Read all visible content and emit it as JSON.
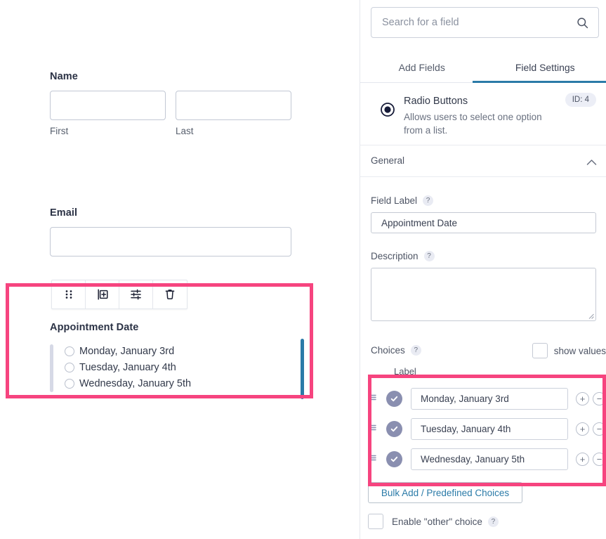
{
  "colors": {
    "highlight_pink": "#f6447f",
    "accent_blue": "#2b7ba8",
    "choice_check": "#8a8fb0",
    "active_bar": "#d6d9e6"
  },
  "form_preview": {
    "name_field": {
      "label": "Name",
      "first": {
        "value": "",
        "sublabel": "First"
      },
      "last": {
        "value": "",
        "sublabel": "Last"
      }
    },
    "email_field": {
      "label": "Email",
      "value": ""
    },
    "toolbar": {
      "drag_title": "Move",
      "duplicate_title": "Duplicate",
      "settings_title": "Settings",
      "delete_title": "Delete"
    },
    "appointment_field": {
      "label": "Appointment Date",
      "choices": [
        "Monday, January 3rd",
        "Tuesday, January 4th",
        "Wednesday, January 5th"
      ]
    }
  },
  "settings_panel": {
    "search": {
      "placeholder": "Search for a field",
      "value": ""
    },
    "tabs": [
      {
        "label": "Add Fields",
        "active": false
      },
      {
        "label": "Field Settings",
        "active": true
      }
    ],
    "field_type": {
      "name": "Radio Buttons",
      "description": "Allows users to select one option from a list.",
      "id_badge": "ID: 4"
    },
    "general": {
      "title": "General"
    },
    "field_label": {
      "label": "Field Label",
      "help": "?",
      "value": "Appointment Date"
    },
    "description": {
      "label": "Description",
      "help": "?",
      "value": ""
    },
    "choices": {
      "label": "Choices",
      "help": "?",
      "show_values_label": "show values",
      "show_values_checked": false,
      "column_header": "Label",
      "items": [
        {
          "label": "Monday, January 3rd",
          "selected": true
        },
        {
          "label": "Tuesday, January 4th",
          "selected": true
        },
        {
          "label": "Wednesday, January 5th",
          "selected": true
        }
      ],
      "add_symbol": "+",
      "remove_symbol": "−"
    },
    "bulk_add_button": "Bulk Add / Predefined Choices",
    "enable_other": {
      "label": "Enable \"other\" choice",
      "help": "?",
      "checked": false
    }
  }
}
